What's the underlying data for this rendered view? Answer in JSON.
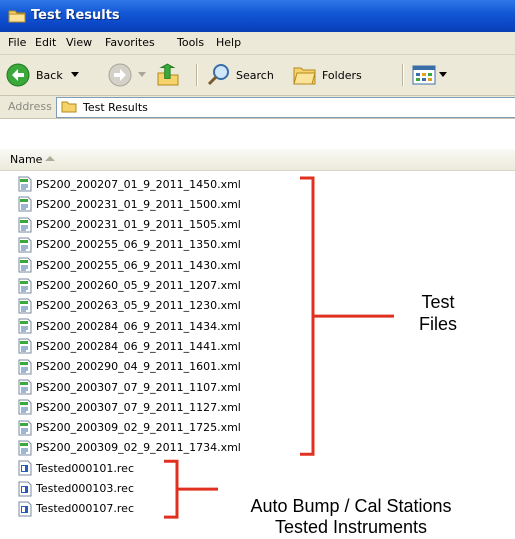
{
  "window": {
    "title": "Test Results"
  },
  "menu": [
    "File",
    "Edit",
    "View",
    "Favorites",
    "Tools",
    "Help"
  ],
  "toolbar": {
    "back_label": "Back",
    "search_label": "Search",
    "folders_label": "Folders"
  },
  "address": {
    "label": "Address",
    "value": "Test Results"
  },
  "list_header": {
    "name_label": "Name"
  },
  "files": [
    "PS200_200207_01_9_2011_1450.xml",
    "PS200_200231_01_9_2011_1500.xml",
    "PS200_200231_01_9_2011_1505.xml",
    "PS200_200255_06_9_2011_1350.xml",
    "PS200_200255_06_9_2011_1430.xml",
    "PS200_200260_05_9_2011_1207.xml",
    "PS200_200263_05_9_2011_1230.xml",
    "PS200_200284_06_9_2011_1434.xml",
    "PS200_200284_06_9_2011_1441.xml",
    "PS200_200290_04_9_2011_1601.xml",
    "PS200_200307_07_9_2011_1107.xml",
    "PS200_200307_07_9_2011_1127.xml",
    "PS200_200309_02_9_2011_1725.xml",
    "PS200_200309_02_9_2011_1734.xml",
    "Tested000101.rec",
    "Tested000103.rec",
    "Tested000107.rec"
  ],
  "annotations": {
    "test_files_line1": "Test",
    "test_files_line2": "Files",
    "stations_line1": "Auto Bump / Cal Stations",
    "stations_line2": "Tested Instruments"
  },
  "colors": {
    "annotation_red": "#e03020",
    "title_blue": "#1458d6"
  },
  "icons": [
    "folder-icon",
    "back-arrow-icon",
    "forward-arrow-icon",
    "up-folder-icon",
    "search-icon",
    "folders-icon",
    "views-icon",
    "xml-file-icon",
    "rec-file-icon"
  ]
}
